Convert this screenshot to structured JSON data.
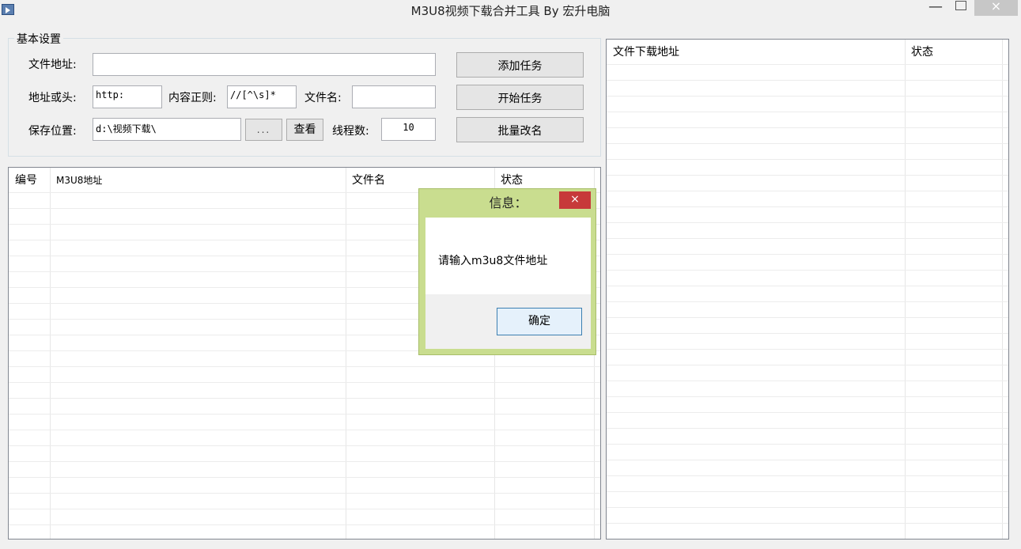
{
  "window": {
    "title": "M3U8视频下载合并工具 By 宏升电脑",
    "minimize_glyph": "—",
    "close_glyph": "×",
    "icon": "app-video-icon"
  },
  "settings": {
    "legend": "基本设置",
    "file_url_label": "文件地址:",
    "file_url_value": "",
    "prefix_label": "地址或头:",
    "prefix_value": "http:",
    "regex_label": "内容正则:",
    "regex_value": "//[^\\s]*",
    "filename_label": "文件名:",
    "filename_value": "",
    "save_label": "保存位置:",
    "save_value": "d:\\视频下载\\",
    "browse_label": "...",
    "view_label": "查看",
    "threads_label": "线程数:",
    "threads_value": "10",
    "add_task_label": "添加任务",
    "start_task_label": "开始任务",
    "batch_rename_label": "批量改名"
  },
  "task_list": {
    "columns": [
      "编号",
      "M3U8地址",
      "文件名",
      "状态"
    ]
  },
  "download_list": {
    "columns": [
      "文件下载地址",
      "状态"
    ]
  },
  "dialog": {
    "title": "信息：",
    "message": "请输入m3u8文件地址",
    "ok_label": "确定",
    "close_glyph": "×"
  }
}
